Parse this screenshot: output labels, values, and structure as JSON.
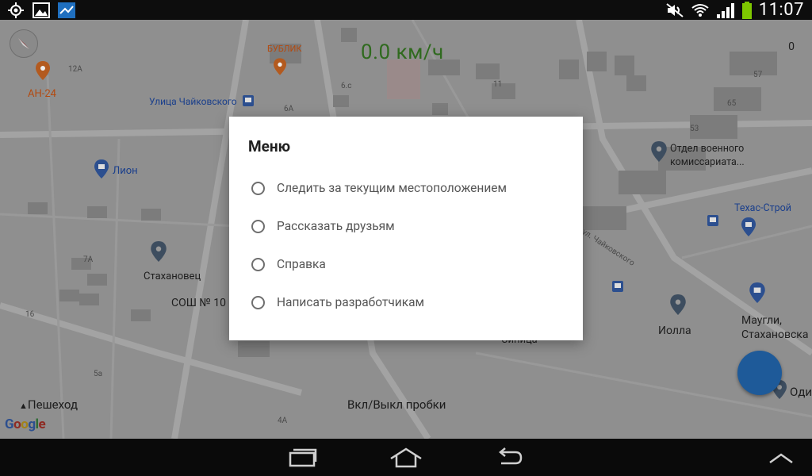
{
  "status_bar": {
    "time": "11:07",
    "left_icons": [
      "location-icon",
      "gallery-icon",
      "app-icon"
    ],
    "right_icons": [
      "mute-icon",
      "wifi-icon",
      "signal-icon",
      "battery-icon"
    ]
  },
  "map": {
    "speed": "0.0 км/ч",
    "scale_value": "0",
    "labels": {
      "an24": "АН-24",
      "n12a": "12А",
      "bublik": "БУБЛИК",
      "n6c": "6.с",
      "n11": "11",
      "n57": "57",
      "n65": "65",
      "n53": "53",
      "street_chaikovskogo": "Улица Чайковского",
      "lion": "Лион",
      "otdel": "Отдел военного",
      "komissariata": "комиссариата...",
      "texas": "Техас-Строй",
      "ul_chaik": "ул. Чайковского",
      "n7a": "7А",
      "stakhanovets": "Стахановец",
      "sosh": "СОШ № 10",
      "n16": "16",
      "n5a": "5а",
      "n6a": "6А",
      "n4a": "4А",
      "sinitsa": "Синица",
      "iolla": "Иолла",
      "maugli": "Маугли,",
      "stakhanovskaya": "Стахановска",
      "odi": "Оди"
    },
    "pedestrian": "Пешеход",
    "traffic_toggle": "Вкл/Выкл пробки",
    "google": [
      "G",
      "o",
      "o",
      "g",
      "l",
      "e"
    ]
  },
  "dialog": {
    "title": "Меню",
    "options": [
      "Следить за текущим местоположением",
      "Рассказать друзьям",
      "Справка",
      "Написать разработчикам"
    ]
  },
  "nav_bar": {
    "buttons": [
      "recent-apps-icon",
      "home-icon",
      "back-icon",
      "up-chevron-icon"
    ]
  }
}
